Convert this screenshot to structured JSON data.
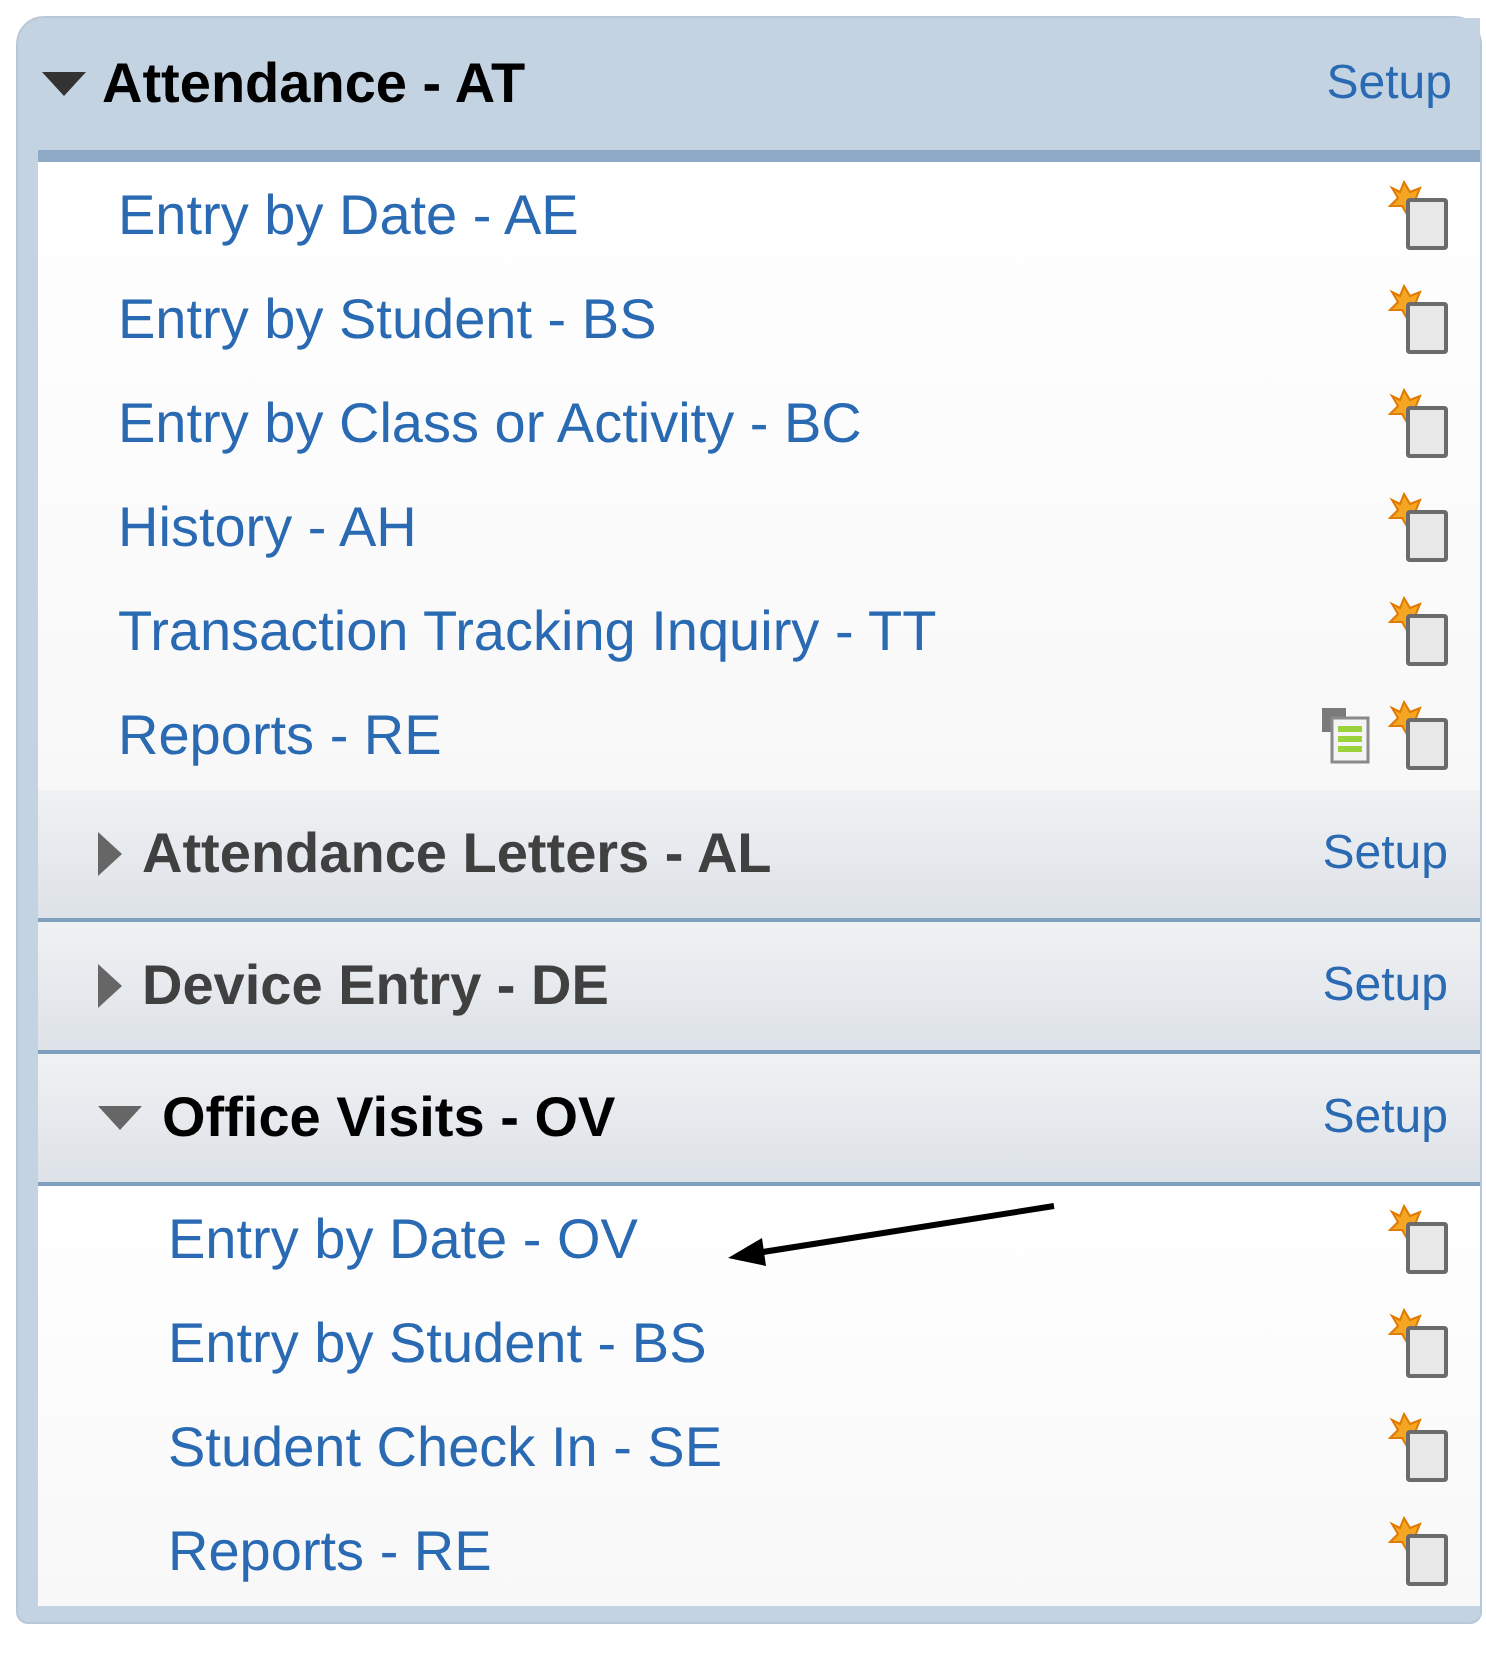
{
  "sections": [
    {
      "kind": "module",
      "title": "Attendance - AT",
      "expanded": true,
      "setup": "Setup",
      "items": [
        {
          "label": "Entry by Date - AE",
          "kind": "plain"
        },
        {
          "label": "Entry by Student - BS",
          "kind": "plain"
        },
        {
          "label": "Entry by Class or Activity - BC",
          "kind": "plain"
        },
        {
          "label": "History - AH",
          "kind": "plain"
        },
        {
          "label": "Transaction Tracking Inquiry - TT",
          "kind": "plain"
        },
        {
          "label": "Reports - RE",
          "kind": "report"
        }
      ]
    },
    {
      "kind": "submodule",
      "title": "Attendance Letters - AL",
      "expanded": false,
      "setup": "Setup"
    },
    {
      "kind": "submodule",
      "title": "Device Entry - DE",
      "expanded": false,
      "setup": "Setup"
    },
    {
      "kind": "submodule",
      "title": "Office Visits - OV",
      "expanded": true,
      "setup": "Setup",
      "items": [
        {
          "label": "Entry by Date - OV",
          "kind": "plain"
        },
        {
          "label": "Entry by Student - BS",
          "kind": "plain"
        },
        {
          "label": "Student Check In - SE",
          "kind": "plain"
        },
        {
          "label": "Reports - RE",
          "kind": "plain"
        }
      ]
    }
  ]
}
